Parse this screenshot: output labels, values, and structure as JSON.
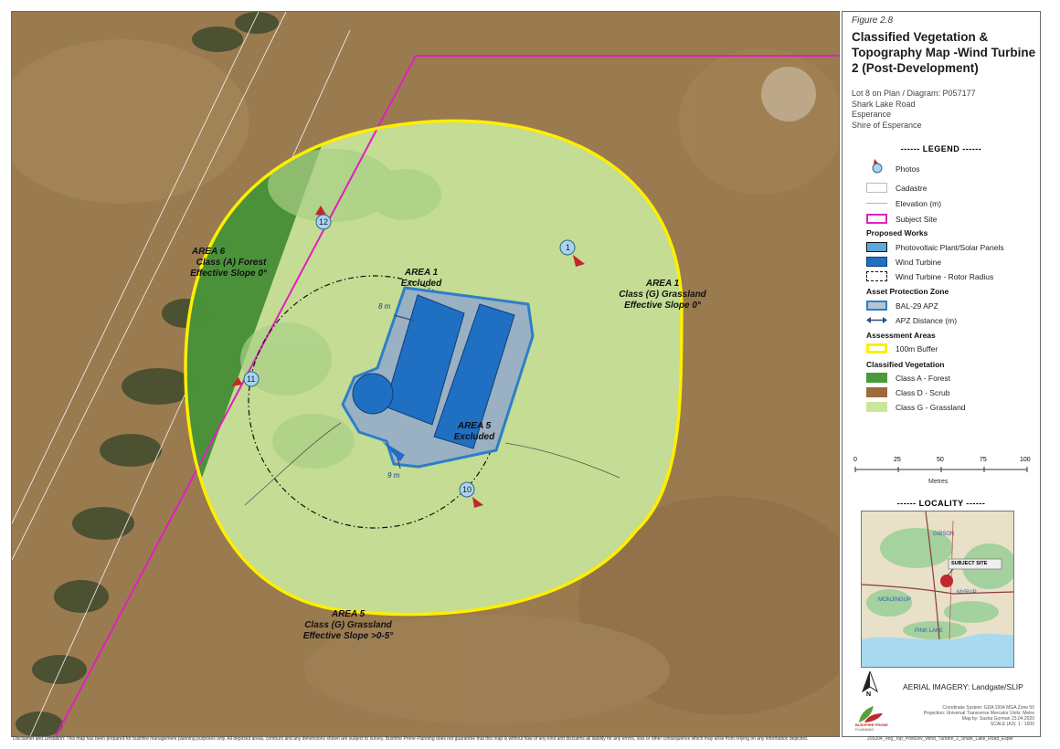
{
  "figure_label": "Figure 2.8",
  "title": "Classified Vegetation & Topography Map -Wind Turbine 2 (Post-Development)",
  "location_lines": [
    "Lot 8 on Plan / Diagram: P057177",
    "Shark Lake Road",
    "Esperance",
    "Shire of Esperance"
  ],
  "legend": {
    "heading": "------ LEGEND ------",
    "items": [
      {
        "label": "Photos",
        "icon": "photo-marker-icon"
      },
      {
        "label": "Cadastre",
        "icon": "cadastre-line",
        "color": "#ffffff"
      },
      {
        "label": "Elevation (m)",
        "icon": "elevation-line",
        "color": "#c8b86a"
      },
      {
        "label": "Subject Site",
        "icon": "subject-site-outline",
        "color": "#e020c0"
      }
    ],
    "proposed_works": {
      "heading": "Proposed Works",
      "items": [
        {
          "label": "Photovoltaic Plant/Solar Panels",
          "color": "#5aa9d6"
        },
        {
          "label": "Wind Turbine",
          "color": "#1f6fc2"
        },
        {
          "label": "Wind Turbine - Rotor Radius",
          "color": "#111111"
        }
      ]
    },
    "apz": {
      "heading": "Asset Protection Zone",
      "items": [
        {
          "label": "BAL-29 APZ",
          "color": "#b5c4d2"
        },
        {
          "label": "APZ Distance (m)",
          "color": "#2a4f7a"
        }
      ]
    },
    "assessment": {
      "heading": "Assessment Areas",
      "items": [
        {
          "label": "100m Buffer",
          "color": "#ffee00"
        }
      ]
    },
    "vegetation": {
      "heading": "Classified Vegetation",
      "items": [
        {
          "label": "Class A - Forest",
          "color": "#4a9a3a"
        },
        {
          "label": "Class D - Scrub",
          "color": "#9c6b3c"
        },
        {
          "label": "Class G - Grassland",
          "color": "#c9e79a"
        }
      ]
    }
  },
  "scale_bar": {
    "ticks": [
      "0",
      "25",
      "50",
      "75",
      "100"
    ],
    "unit": "Metres"
  },
  "locality": {
    "heading": "------ LOCALITY ------",
    "subject_label": "SUBJECT SITE",
    "towns": [
      "GIBSON",
      "MONJINGUP",
      "MYRUP",
      "PINK LAKE"
    ]
  },
  "aerial_credit": "AERIAL IMAGERY: Landgate/SLIP",
  "north_label": "N",
  "logo_text": [
    "BUSHFIRE PRONE",
    "PLANNING"
  ],
  "meta_lines": [
    "Coordinate System: GDA 1994 MGA Zone 50",
    "Projection: Universal Transverse Mercator  Units: Metre",
    "Map by: Sasha Gorman 23.04.2020",
    "SCALE (A3): 1 : 1500"
  ],
  "doc_ref": "200204_Veg_Top_PostDev_Wind_Turbine_2_Shark_Lake_Road_Esper",
  "disclaimer": "Disclaimer and Limitation: This map has been prepared for bushfire management planning purposes only. All depicted areas, contours and any dimensions shown are subject to survey. Bushfire Prone Planning does not guarantee that this map is without flaw of any kind and disclaims all liability for any errors, loss or other consequence which may arise from relying on any information depicted.",
  "map_labels": {
    "area6": [
      "AREA  6",
      "Class (A)  Forest",
      "Effective Slope 0°"
    ],
    "area1_east": [
      "AREA  1",
      "Class (G)  Grassland",
      "Effective Slope 0°"
    ],
    "area1_excluded": [
      "AREA  1",
      "Excluded"
    ],
    "area5_excluded": [
      "AREA  5",
      "Excluded"
    ],
    "area5_south": [
      "AREA  5",
      "Class (G)  Grassland",
      "Effective Slope >0-5°"
    ],
    "dim_north": "8 m",
    "dim_south": "9 m"
  },
  "photos": [
    {
      "number": "12"
    },
    {
      "number": "1"
    },
    {
      "number": "11"
    },
    {
      "number": "10"
    }
  ]
}
